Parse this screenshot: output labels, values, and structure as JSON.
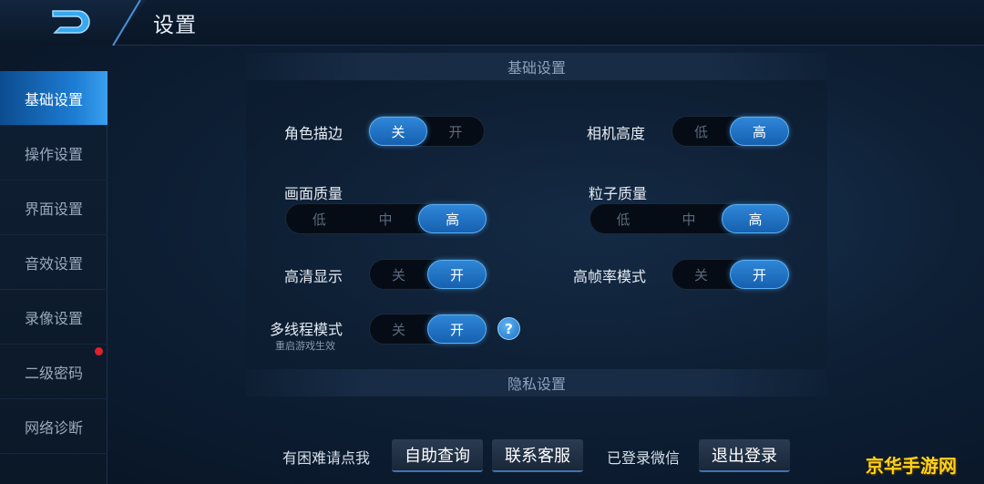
{
  "header": {
    "title": "设置"
  },
  "sidebar": {
    "items": [
      {
        "label": "基础设置",
        "active": true
      },
      {
        "label": "操作设置",
        "active": false
      },
      {
        "label": "界面设置",
        "active": false
      },
      {
        "label": "音效设置",
        "active": false
      },
      {
        "label": "录像设置",
        "active": false
      },
      {
        "label": "二级密码",
        "active": false,
        "badge": "red-dot"
      },
      {
        "label": "网络诊断",
        "active": false
      }
    ]
  },
  "sections": {
    "basic": "基础设置",
    "privacy": "隐私设置"
  },
  "settings": {
    "outline": {
      "label": "角色描边",
      "options": [
        "关",
        "开"
      ],
      "selected": "关"
    },
    "camera": {
      "label": "相机高度",
      "options": [
        "低",
        "高"
      ],
      "selected": "高"
    },
    "quality": {
      "label": "画面质量",
      "options": [
        "低",
        "中",
        "高"
      ],
      "selected": "高"
    },
    "particle": {
      "label": "粒子质量",
      "options": [
        "低",
        "中",
        "高"
      ],
      "selected": "高"
    },
    "hd": {
      "label": "高清显示",
      "options": [
        "关",
        "开"
      ],
      "selected": "开"
    },
    "framerate": {
      "label": "高帧率模式",
      "options": [
        "关",
        "开"
      ],
      "selected": "开"
    },
    "multithread": {
      "label": "多线程模式",
      "sublabel": "重启游戏生效",
      "options": [
        "关",
        "开"
      ],
      "selected": "开"
    }
  },
  "footer": {
    "help_text": "有困难请点我",
    "self_help": "自助查询",
    "contact": "联系客服",
    "login_status": "已登录微信",
    "logout": "退出登录"
  },
  "watermark": "京华手游网",
  "colors": {
    "accent": "#1d7dd4",
    "badge": "#e0202a",
    "watermark": "#ffd21a"
  },
  "icons": {
    "back": "back-arrow-icon",
    "help": "question-mark-icon"
  }
}
